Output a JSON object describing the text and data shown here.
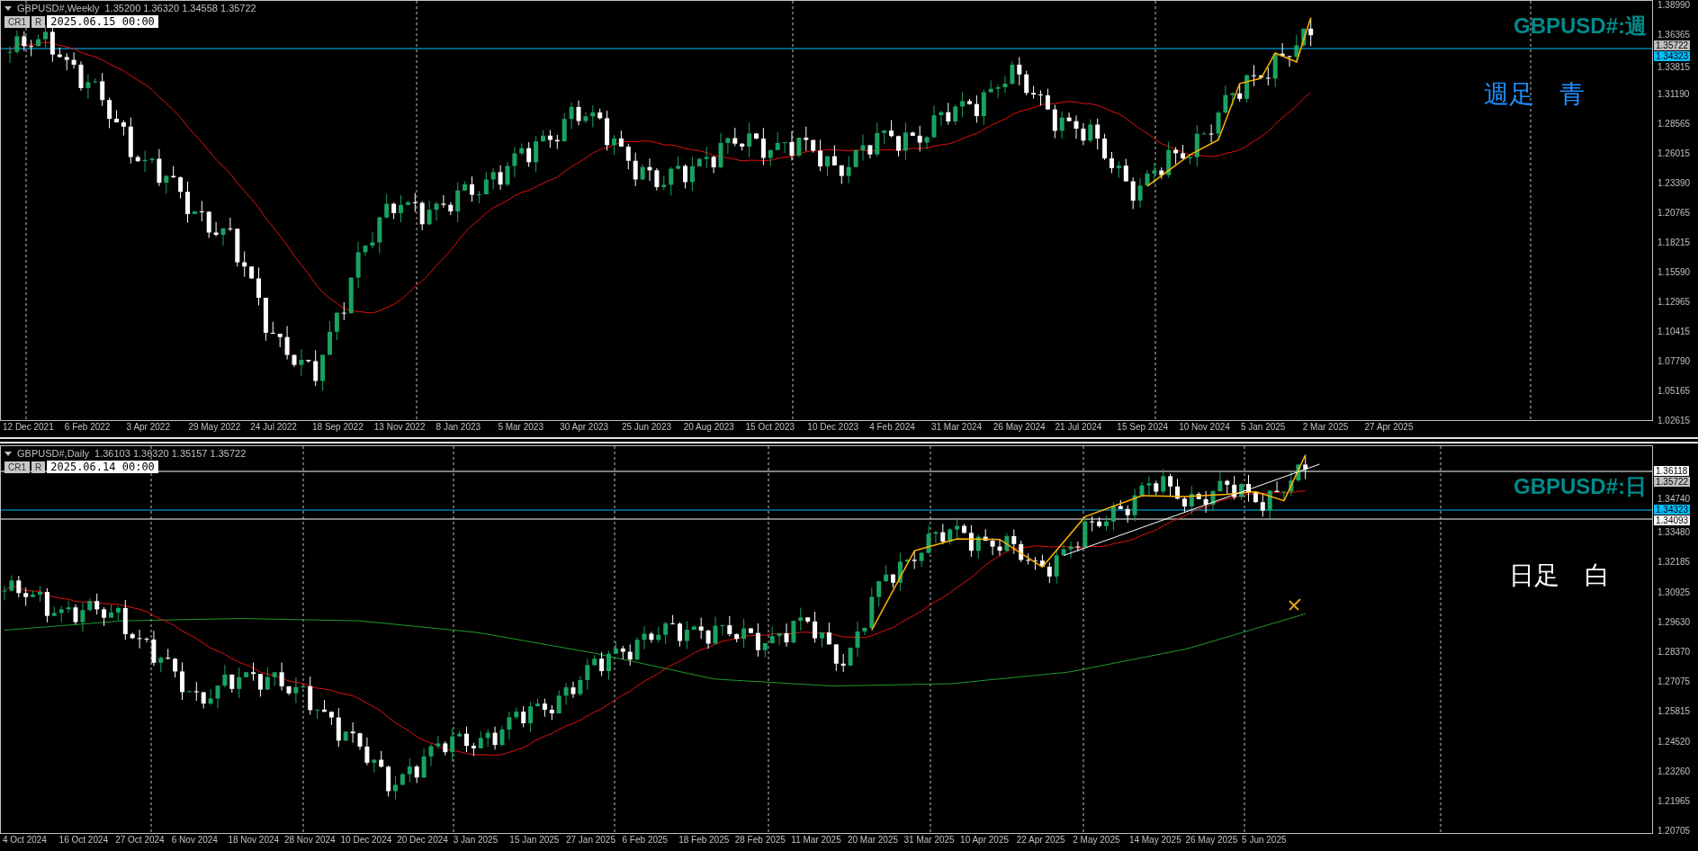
{
  "panes": [
    {
      "title": "GBPUSD#,Weekly",
      "ohlc": "1.35200 1.36320 1.34558 1.35722",
      "buttons": [
        "CR1",
        "R"
      ],
      "date": "2025.06.15 00:00",
      "price_labels": [
        "1.38990",
        "1.36365",
        "1.33815",
        "1.31190",
        "1.28565",
        "1.26015",
        "1.23390",
        "1.20765",
        "1.18215",
        "1.15590",
        "1.12965",
        "1.10415",
        "1.07790",
        "1.05165",
        "1.02615"
      ],
      "price_tags": [
        {
          "text": "1.35722",
          "kind": "current"
        },
        {
          "text": "1.34323",
          "kind": "level"
        }
      ],
      "time_labels": [
        "12 Dec 2021",
        "6 Feb 2022",
        "3 Apr 2022",
        "29 May 2022",
        "24 Jul 2022",
        "18 Sep 2022",
        "13 Nov 2022",
        "8 Jan 2023",
        "5 Mar 2023",
        "30 Apr 2023",
        "25 Jun 2023",
        "20 Aug 2023",
        "15 Oct 2023",
        "10 Dec 2023",
        "4 Feb 2024",
        "31 Mar 2024",
        "26 May 2024",
        "21 Jul 2024",
        "15 Sep 2024",
        "10 Nov 2024",
        "5 Jan 2025",
        "2 Mar 2025",
        "27 Apr 2025"
      ],
      "captions": [
        {
          "text": "GBPUSD#:週",
          "kind": "symbol",
          "color": "#008b8b"
        },
        {
          "text": "週足　青",
          "kind": "note",
          "color": "#1e90ff"
        }
      ]
    },
    {
      "title": "GBPUSD#,Daily",
      "ohlc": "1.36103 1.36320 1.35157 1.35722",
      "buttons": [
        "CR1",
        "R"
      ],
      "date": "2025.06.14 00:00",
      "price_labels": [
        "1.34740",
        "1.33480",
        "1.32185",
        "1.30925",
        "1.29630",
        "1.28370",
        "1.27075",
        "1.25815",
        "1.24520",
        "1.23260",
        "1.21965",
        "1.20705"
      ],
      "price_tags": [
        {
          "text": "1.36118",
          "kind": "line"
        },
        {
          "text": "1.35722",
          "kind": "current"
        },
        {
          "text": "1.34323",
          "kind": "level"
        },
        {
          "text": "1.34093",
          "kind": "line"
        }
      ],
      "time_labels": [
        "4 Oct 2024",
        "16 Oct 2024",
        "27 Oct 2024",
        "6 Nov 2024",
        "18 Nov 2024",
        "28 Nov 2024",
        "10 Dec 2024",
        "20 Dec 2024",
        "3 Jan 2025",
        "15 Jan 2025",
        "27 Jan 2025",
        "6 Feb 2025",
        "18 Feb 2025",
        "28 Feb 2025",
        "11 Mar 2025",
        "20 Mar 2025",
        "31 Mar 2025",
        "10 Apr 2025",
        "22 Apr 2025",
        "2 May 2025",
        "14 May 2025",
        "26 May 2025",
        "5 Jun 2025"
      ],
      "captions": [
        {
          "text": "GBPUSD#:日",
          "kind": "symbol",
          "color": "#008b8b"
        },
        {
          "text": "日足　白",
          "kind": "note",
          "color": "#ffffff"
        }
      ]
    }
  ]
}
